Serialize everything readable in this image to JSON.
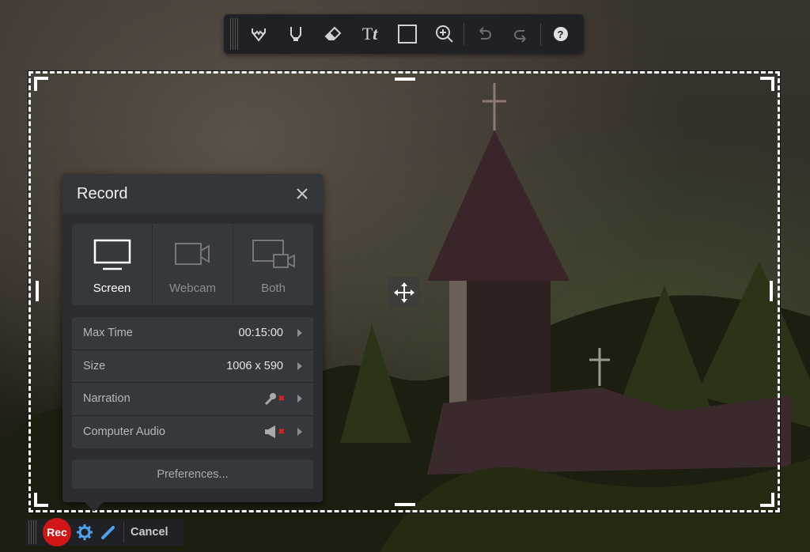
{
  "toolbar": {
    "tools": [
      "pen-icon",
      "highlighter-icon",
      "eraser-icon",
      "text-icon",
      "rectangle-icon",
      "zoom-in-icon",
      "undo-icon",
      "redo-icon",
      "help-icon"
    ]
  },
  "record": {
    "title": "Record",
    "modes": [
      {
        "label": "Screen",
        "active": true
      },
      {
        "label": "Webcam"
      },
      {
        "label": "Both"
      }
    ],
    "settings": [
      {
        "label": "Max Time",
        "value": "00:15:00"
      },
      {
        "label": "Size",
        "value": "1006 x 590"
      },
      {
        "label": "Narration",
        "icon": "microphone-muted-icon"
      },
      {
        "label": "Computer Audio",
        "icon": "speaker-muted-icon"
      }
    ],
    "preferences_label": "Preferences..."
  },
  "bottom": {
    "rec_label": "Rec",
    "cancel_label": "Cancel"
  },
  "colors": {
    "rec": "#d01616",
    "accent": "#4ea3f0"
  }
}
